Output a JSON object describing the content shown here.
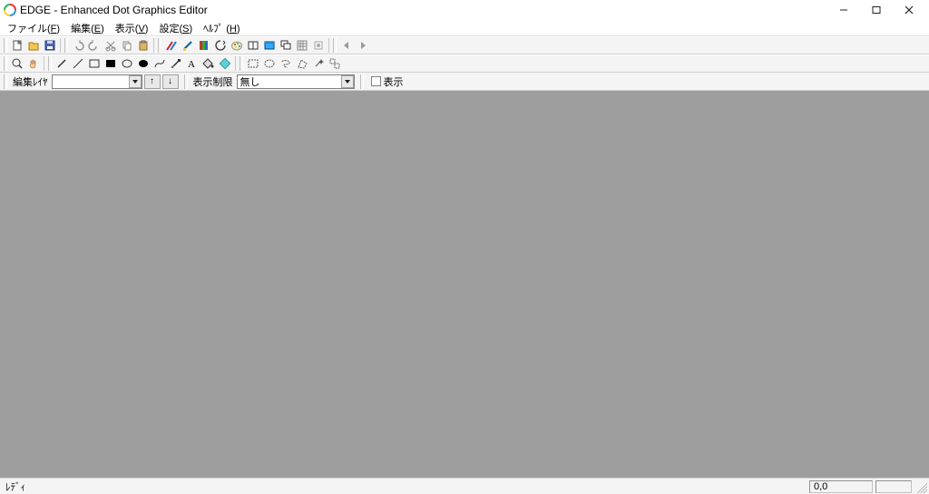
{
  "titlebar": {
    "title": "EDGE - Enhanced Dot Graphics Editor"
  },
  "menu": {
    "file": {
      "label": "ファイル",
      "mn": "F"
    },
    "edit": {
      "label": "編集",
      "mn": "E"
    },
    "view": {
      "label": "表示",
      "mn": "V"
    },
    "settings": {
      "label": "設定",
      "mn": "S"
    },
    "help": {
      "label": "ﾍﾙﾌﾟ",
      "mn": "H"
    }
  },
  "layerbar": {
    "edit_layer_label": "編集ﾚｲﾔ",
    "edit_layer_value": "",
    "up_label": "↑",
    "down_label": "↓",
    "display_limit_label": "表示制限",
    "display_limit_value": "無し",
    "show_checkbox_label": "表示"
  },
  "status": {
    "left": "ﾚﾃﾞｨ",
    "coords": "0,0"
  }
}
